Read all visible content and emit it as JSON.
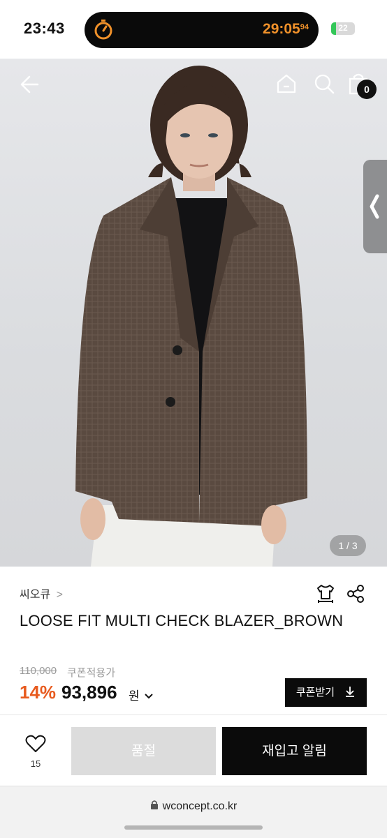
{
  "status_bar": {
    "time": "23:43",
    "timer": "29:05",
    "timer_fraction": "94",
    "battery_level": "22",
    "battery_color": "#34c759",
    "timer_color": "#f0912a"
  },
  "hero": {
    "pager": "1 / 3",
    "cart_count": "0",
    "back_icon": "back-arrow-icon",
    "home_icon": "home-icon",
    "search_icon": "search-icon",
    "cart_icon": "shopping-bag-icon",
    "side_tab_icon": "chevron-left-icon"
  },
  "product": {
    "brand": "씨오큐",
    "brand_chevron": ">",
    "title": "LOOSE FIT MULTI CHECK BLAZER_BROWN",
    "original_price": "110,000",
    "coupon_price_label": "쿠폰적용가",
    "discount": "14%",
    "price": "93,896",
    "currency": "원",
    "coupon_button": "쿠폰받기",
    "discount_color": "#e85b1f"
  },
  "actions": {
    "like_count": "15",
    "soldout_label": "품절",
    "restock_label": "재입고 알림"
  },
  "browser": {
    "url": "wconcept.co.kr"
  }
}
